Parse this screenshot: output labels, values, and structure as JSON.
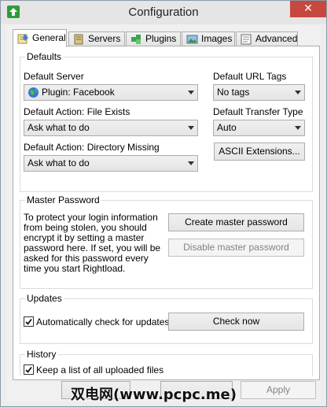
{
  "window": {
    "title": "Configuration",
    "close_glyph": "✕"
  },
  "tabs": [
    {
      "label": "General",
      "icon": "general-icon"
    },
    {
      "label": "Servers",
      "icon": "servers-icon"
    },
    {
      "label": "Plugins",
      "icon": "plugins-icon"
    },
    {
      "label": "Images",
      "icon": "images-icon"
    },
    {
      "label": "Advanced",
      "icon": "advanced-icon"
    }
  ],
  "defaults": {
    "title": "Defaults",
    "server_label": "Default Server",
    "server_value": "Plugin: Facebook",
    "file_exists_label": "Default Action: File Exists",
    "file_exists_value": "Ask what to do",
    "dir_missing_label": "Default Action: Directory Missing",
    "dir_missing_value": "Ask what to do",
    "url_tags_label": "Default URL Tags",
    "url_tags_value": "No tags",
    "transfer_label": "Default Transfer Type",
    "transfer_value": "Auto",
    "ascii_button": "ASCII Extensions..."
  },
  "master_password": {
    "title": "Master Password",
    "description": "To protect your login information from being stolen, you should encrypt it by setting a master password here. If set, you will be asked for this password every time you start Rightload.",
    "create_button": "Create master password",
    "disable_button": "Disable master password"
  },
  "updates": {
    "title": "Updates",
    "auto_check_label": "Automatically check for updates",
    "auto_check_checked": true,
    "check_now_button": "Check now"
  },
  "history": {
    "title": "History",
    "keep_list_label": "Keep a list of all uploaded files",
    "keep_list_checked": true
  },
  "footer": {
    "apply_button": "Apply",
    "watermark": "双电网(www.pcpc.me)"
  },
  "colors": {
    "accent_green": "#2e9b3a",
    "close_red": "#c7483e"
  }
}
